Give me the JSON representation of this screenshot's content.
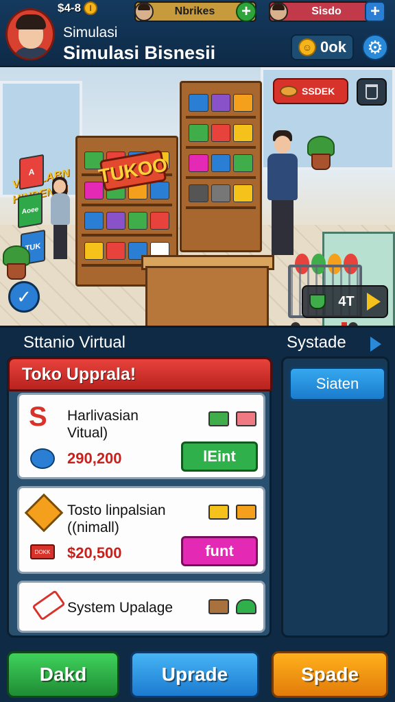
{
  "hud": {
    "currency": "$4-8",
    "coin_mark": "I",
    "player_a": "Nbrikes",
    "player_b": "Sisdo",
    "subtitle": "Simulasi",
    "title": "Simulasi Bisnesii",
    "ok_label": "0ok"
  },
  "scene": {
    "shop_sign": "TUKOO",
    "wall_sign_line1": "VIONLABN",
    "wall_sign_line2": "HINDENSII",
    "poster_1": "A",
    "poster_2": "Aoee",
    "poster_3": "TUK",
    "stock_label": "SSDEK",
    "speed_label": "4T"
  },
  "section": {
    "left_title": "Sttanio Virtual",
    "right_title": "Systade"
  },
  "panel": {
    "header": "Toko Upprala!",
    "items": [
      {
        "icon": "S",
        "title_line1": "Harlivasian",
        "title_line2": "Vitual)",
        "price": "290,200",
        "button": "lEint"
      },
      {
        "title_line1": "Tosto linpalsian",
        "title_line2": "((nimall)",
        "price": "$20,500",
        "button": "funt",
        "tag": "DOKK"
      },
      {
        "title_line1": "System Upalage"
      }
    ]
  },
  "side": {
    "button": "Siaten"
  },
  "bottom": {
    "left": "Dakd",
    "center": "Uprade",
    "right": "Spade"
  },
  "colors": {
    "hud_bg": "#143a5e",
    "header_red": "#e8423c",
    "green": "#2fb04a",
    "pink": "#e42ab4",
    "blue": "#2a8ad8",
    "orange": "#ffb01c"
  }
}
